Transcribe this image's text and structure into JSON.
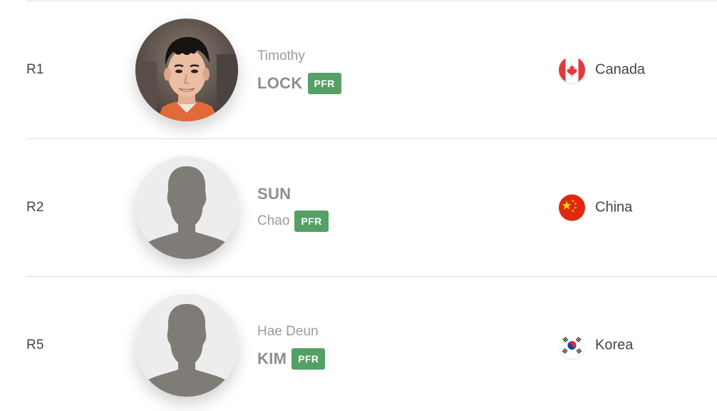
{
  "players": [
    {
      "round": "R1",
      "first_line": "Timothy",
      "second_line": "LOCK",
      "badge": "PFR",
      "country": "Canada",
      "flag_icon": "canada-flag-icon",
      "avatar": "player-photo"
    },
    {
      "round": "R2",
      "first_line": "SUN",
      "second_line": "Chao",
      "badge": "PFR",
      "country": "China",
      "flag_icon": "china-flag-icon",
      "avatar": "placeholder-silhouette"
    },
    {
      "round": "R5",
      "first_line": "Hae Deun",
      "second_line": "KIM",
      "badge": "PFR",
      "country": "Korea",
      "flag_icon": "korea-flag-icon",
      "avatar": "placeholder-silhouette"
    }
  ],
  "colors": {
    "badge_bg": "#55a065",
    "divider": "#dcdcdc",
    "silhouette": "#7f7c77",
    "avatar_bg": "#ededed"
  }
}
